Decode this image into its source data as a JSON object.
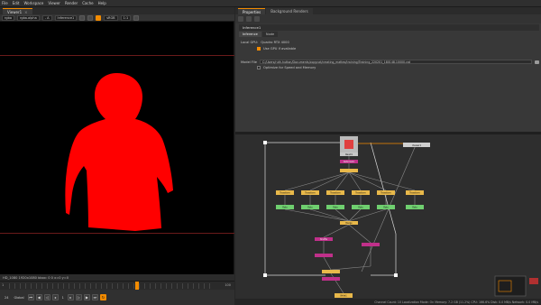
{
  "menubar": {
    "items": [
      "File",
      "Edit",
      "Workspace",
      "Viewer",
      "Render",
      "Cache",
      "Help"
    ]
  },
  "viewer": {
    "tab_label": "Viewer1",
    "channel": "rgba",
    "layer": "rgba.alpha",
    "input_a": "- A",
    "input_b": "Inference1",
    "gain": "sRGB",
    "zoom": "1:1",
    "status": "HD_1080 1920x1080  bbox: 0 0  x=0 y=0",
    "timeline_start": "1",
    "timeline_end": "100",
    "frame": "1",
    "fps": "24",
    "playback": "Global"
  },
  "panel": {
    "tabs": [
      "Properties",
      "Background Renders"
    ],
    "node_name": "Inference1",
    "subtabs": [
      "Inference",
      "Node"
    ],
    "local_gpu_label": "Local GPU:",
    "local_gpu_value": "Quadro RTX 4000",
    "use_gpu_label": "Use GPU if available",
    "model_file_label": "Model File",
    "model_file_value": "C:/Users/ruth.hutton/Documents/copycat/creating_mattes/training/Training_220201_180148.10000.cat",
    "optimize_label": "Optimize for Speed and Memory"
  },
  "nodegraph": {
    "read_label": "Read1",
    "reformat_label": "Reformat1",
    "transform_label": "Transform",
    "roto_label": "Roto",
    "shuffle_label": "Shuffle",
    "merge_label": "Merge",
    "write_label": "Write1",
    "viewer_label": "Viewer1"
  },
  "statusbar": {
    "text": "Channel Count: 10  Localization Mode: On  Memory: 7.2 GB (11.2%)  CPU: 166.6%  Disk: 0.0 MB/s  Network: 0.0 MB/s"
  },
  "colors": {
    "accent": "#f38b00",
    "matte": "#ff0000",
    "node_green": "#6fcf6f",
    "node_orange": "#e8b84a",
    "node_magenta": "#c0308a"
  }
}
